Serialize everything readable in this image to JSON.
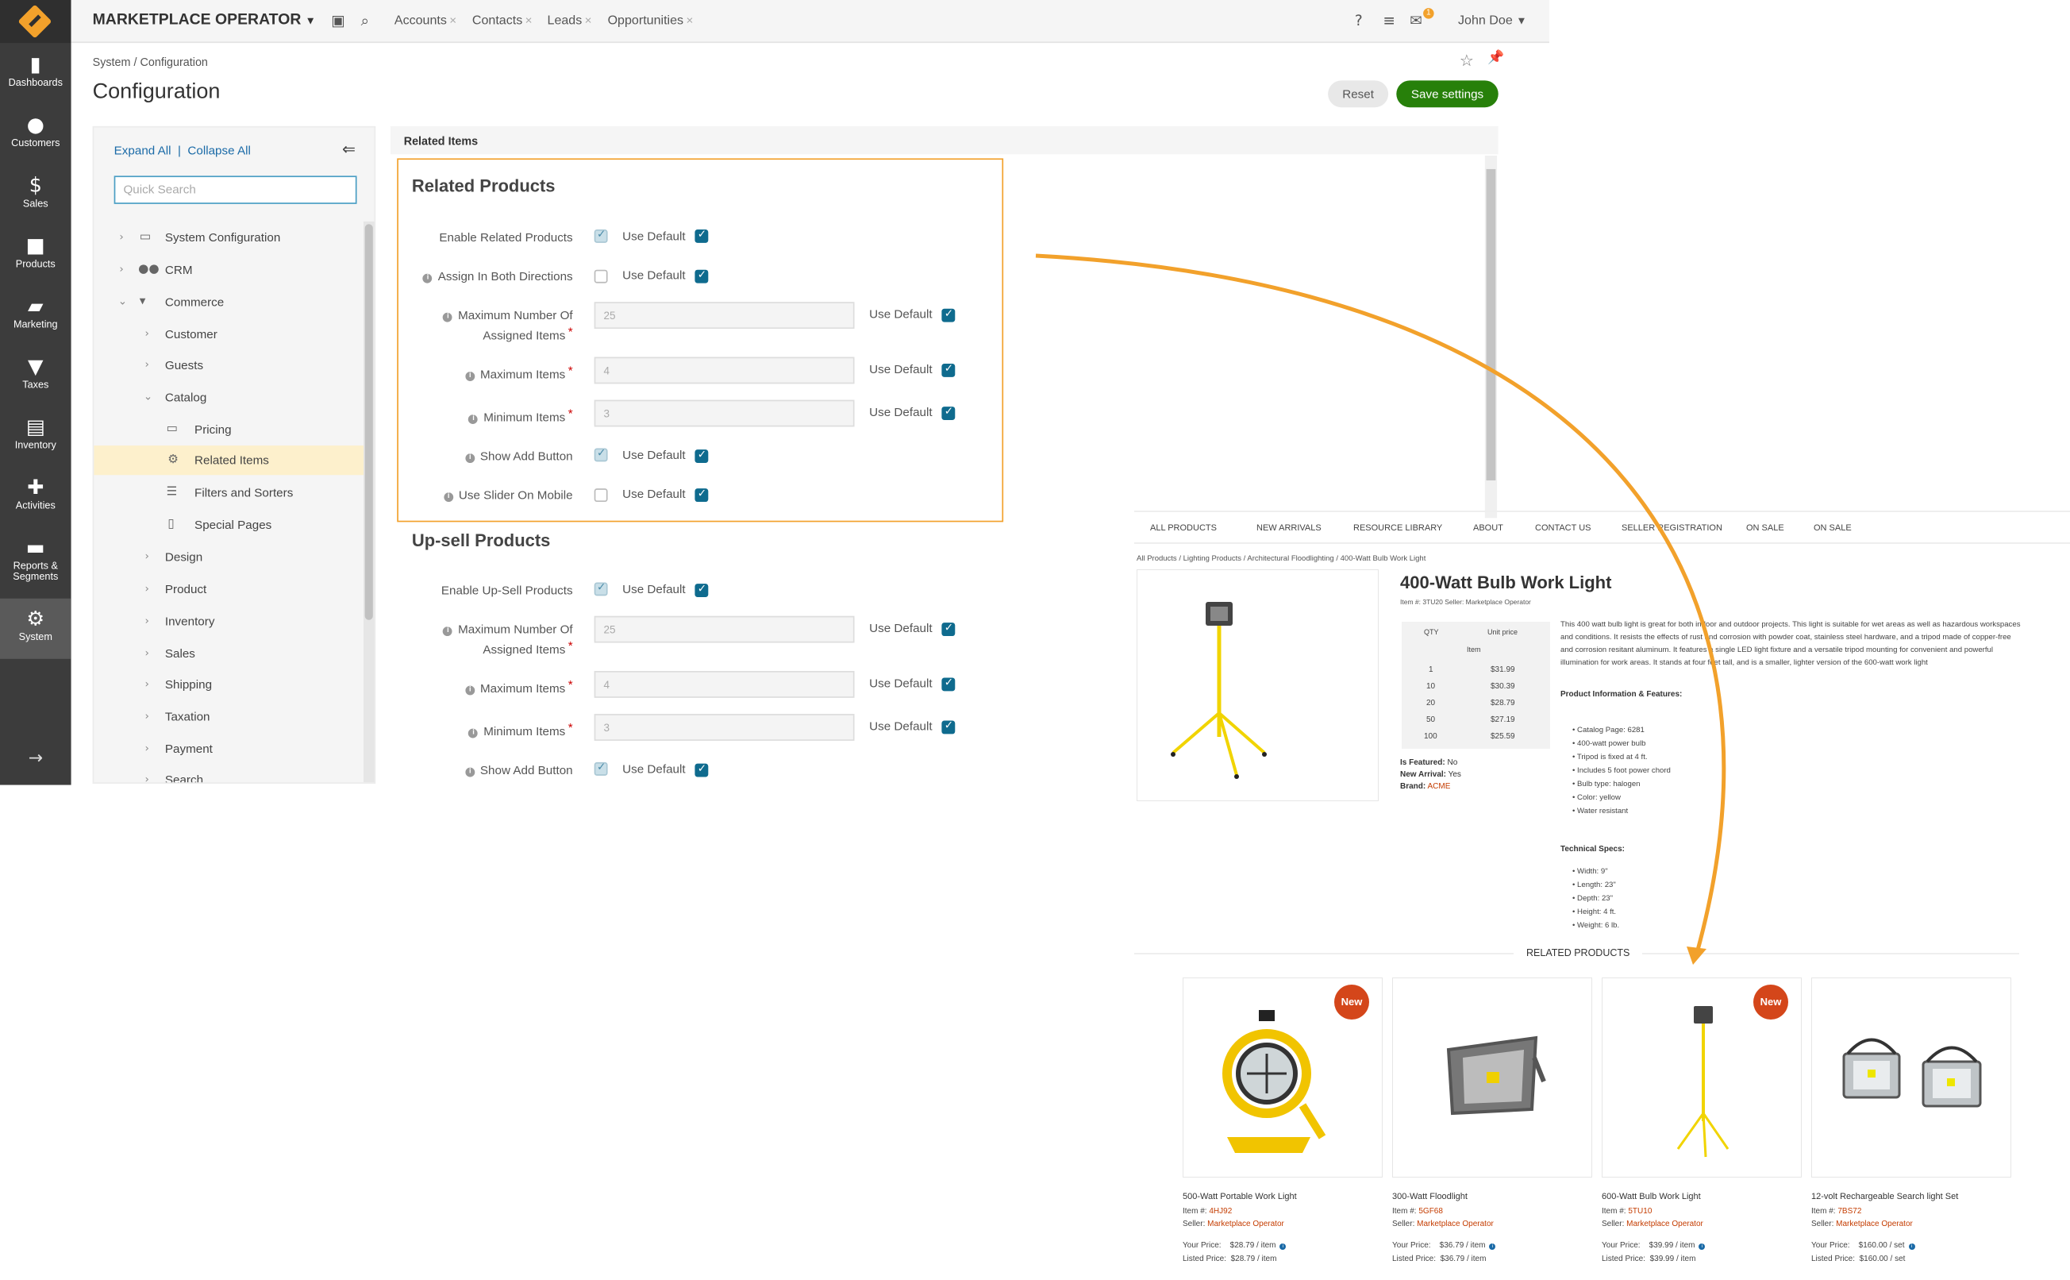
{
  "nav": {
    "items": [
      {
        "icon": "dashboards-icon",
        "glyph": "▮",
        "label": "Dashboards"
      },
      {
        "icon": "customers-icon",
        "glyph": "●",
        "label": "Customers"
      },
      {
        "icon": "sales-icon",
        "glyph": "$",
        "label": "Sales"
      },
      {
        "icon": "products-icon",
        "glyph": "■",
        "label": "Products"
      },
      {
        "icon": "marketing-icon",
        "glyph": "▰",
        "label": "Marketing"
      },
      {
        "icon": "taxes-icon",
        "glyph": "▼",
        "label": "Taxes"
      },
      {
        "icon": "inventory-icon",
        "glyph": "▤",
        "label": "Inventory"
      },
      {
        "icon": "activities-icon",
        "glyph": "✚",
        "label": "Activities"
      },
      {
        "icon": "reports-icon",
        "glyph": "▬",
        "label": "Reports &",
        "label2": "Segments"
      },
      {
        "icon": "system-icon",
        "glyph": "⚙",
        "label": "System"
      }
    ],
    "expand_glyph": "→"
  },
  "topbar": {
    "brand": "MARKETPLACE OPERATOR",
    "tabs": [
      "Accounts",
      "Contacts",
      "Leads",
      "Opportunities"
    ],
    "tab_close": "×",
    "notification_count": "1",
    "user": "John Doe"
  },
  "page": {
    "breadcrumb": "System / Configuration",
    "title": "Configuration",
    "reset_label": "Reset",
    "save_label": "Save settings"
  },
  "tree": {
    "expand_all": "Expand All",
    "collapse_all": "Collapse All",
    "search_placeholder": "Quick Search",
    "items": [
      "System Configuration",
      "CRM",
      "Commerce",
      "Customer",
      "Guests",
      "Catalog",
      "Pricing",
      "Related Items",
      "Filters and Sorters",
      "Special Pages",
      "Design",
      "Product",
      "Inventory",
      "Sales",
      "Shipping",
      "Taxation",
      "Payment",
      "Search"
    ]
  },
  "content": {
    "section_title": "Related Items",
    "use_default_label": "Use Default",
    "related": {
      "title": "Related Products",
      "enable": "Enable Related Products",
      "both_dirs": "Assign In Both Directions",
      "max_assigned_1": "Maximum Number Of",
      "max_assigned_2": "Assigned Items",
      "max_assigned_value": "25",
      "max_items": "Maximum Items",
      "max_items_value": "4",
      "min_items": "Minimum Items",
      "min_items_value": "3",
      "show_add": "Show Add Button",
      "slider": "Use Slider On Mobile"
    },
    "upsell": {
      "title": "Up-sell Products",
      "enable": "Enable Up-Sell Products",
      "max_assigned_1": "Maximum Number Of",
      "max_assigned_2": "Assigned Items",
      "max_assigned_value": "25",
      "max_items": "Maximum Items",
      "max_items_value": "4",
      "min_items": "Minimum Items",
      "min_items_value": "3",
      "show_add": "Show Add Button"
    }
  },
  "store": {
    "nav": [
      "ALL PRODUCTS",
      "NEW ARRIVALS",
      "RESOURCE LIBRARY",
      "ABOUT",
      "CONTACT US",
      "SELLER REGISTRATION",
      "ON SALE",
      "ON SALE"
    ],
    "breadcrumb": "All Products / Lighting Products / Architectural Floodlighting / 400-Watt Bulb Work Light",
    "title": "400-Watt Bulb Work Light",
    "item_line": "Item #: 3TU20   Seller: Marketplace Operator",
    "qty_header": "QTY",
    "unit_header": "Unit price",
    "unit_sub": "Item",
    "prices": [
      {
        "qty": "1",
        "price": "$31.99"
      },
      {
        "qty": "10",
        "price": "$30.39"
      },
      {
        "qty": "20",
        "price": "$28.79"
      },
      {
        "qty": "50",
        "price": "$27.19"
      },
      {
        "qty": "100",
        "price": "$25.59"
      }
    ],
    "featured_label": "Is Featured:",
    "featured_value": "No",
    "new_label": "New Arrival:",
    "new_value": "Yes",
    "brand_label": "Brand:",
    "brand_value": "ACME",
    "description": "This 400 watt bulb light is great for both indoor and outdoor projects. This light is suitable for wet areas as well as hazardous workspaces and conditions. It resists the effects of rust and corrosion with powder coat, stainless steel hardware, and a tripod made of copper-free and corrosion resitant aluminum. It features a single LED light fixture and a versatile tripod mounting for convenient and powerful illumination for work areas. It stands at four feet tall, and is a smaller, lighter version of the 600-watt work light",
    "info_heading": "Product Information & Features:",
    "features": [
      "Catalog Page: 6281",
      "400-watt power bulb",
      "Tripod is fixed at 4 ft.",
      "Includes 5 foot power chord",
      "Bulb type: halogen",
      "Color: yellow",
      "Water resistant"
    ],
    "specs_heading": "Technical Specs:",
    "specs": [
      "Width: 9\"",
      "Length: 23\"",
      "Depth: 23\"",
      "Height: 4 ft.",
      "Weight: 6 lb."
    ],
    "related_title": "RELATED PRODUCTS",
    "new_badge": "New",
    "your_price_label": "Your Price:",
    "listed_price_label": "Listed Price:",
    "item_label": "Item #:",
    "seller_label": "Seller:",
    "seller_value": "Marketplace Operator",
    "info_glyph": "i",
    "cards": [
      {
        "name": "500-Watt Portable Work Light",
        "item": "4HJ92",
        "your_price": "$28.79 / item",
        "listed_price": "$28.79 / item"
      },
      {
        "name": "300-Watt Floodlight",
        "item": "5GF68",
        "your_price": "$36.79 / item",
        "listed_price": "$36.79 / item"
      },
      {
        "name": "600-Watt Bulb Work Light",
        "item": "5TU10",
        "your_price": "$39.99 / item",
        "listed_price": "$39.99 / item"
      },
      {
        "name": "12-volt Rechargeable Search light Set",
        "item": "7BS72",
        "your_price": "$160.00 / set",
        "listed_price": "$160.00 / set"
      }
    ]
  },
  "colors": {
    "accent": "#f2a12b",
    "save": "#27800a",
    "link": "#1a6aa7",
    "seller": "#c43c00",
    "badge": "#d4461a",
    "checkbox": "#0f6b8e"
  }
}
